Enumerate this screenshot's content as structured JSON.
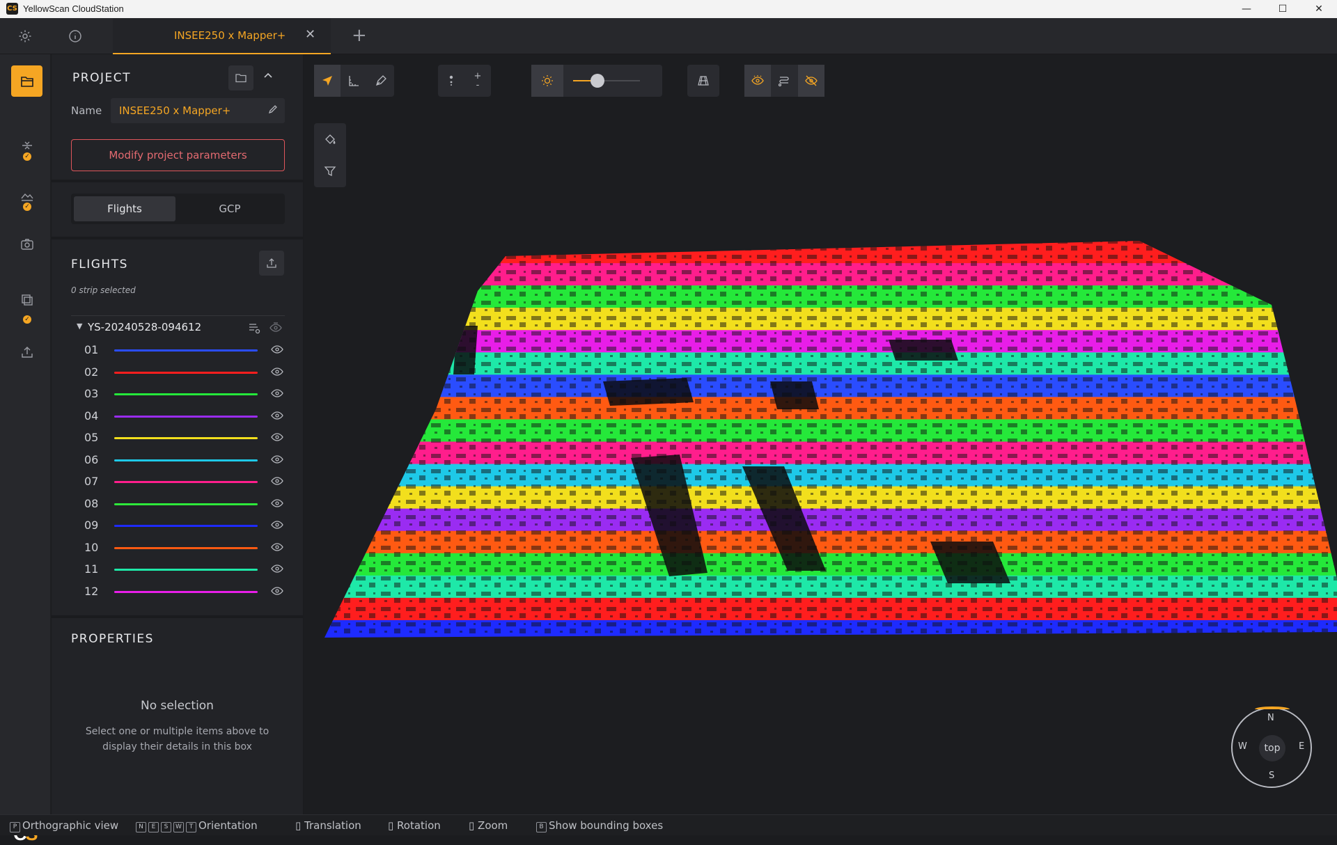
{
  "window": {
    "title": "YellowScan CloudStation",
    "minimize": "—",
    "maximize": "☐",
    "close": "✕",
    "app_badge": "CS"
  },
  "tabs": {
    "active_label": "INSEE250 x Mapper+",
    "close": "✕",
    "add": "+"
  },
  "rail": {
    "logo_c": "C",
    "logo_s": "S"
  },
  "project": {
    "header": "PROJECT",
    "name_label": "Name",
    "name_value": "INSEE250 x Mapper+",
    "modify_button": "Modify project parameters",
    "segment": {
      "flights": "Flights",
      "gcp": "GCP"
    }
  },
  "flights": {
    "header": "FLIGHTS",
    "selection": "0 strip selected",
    "group_name": "YS-20240528-094612",
    "strips": [
      {
        "num": "01",
        "color": "#2a4dff"
      },
      {
        "num": "02",
        "color": "#ff1e1e"
      },
      {
        "num": "03",
        "color": "#25e83a"
      },
      {
        "num": "04",
        "color": "#9a2cf2"
      },
      {
        "num": "05",
        "color": "#f2df1d"
      },
      {
        "num": "06",
        "color": "#1ec9e8"
      },
      {
        "num": "07",
        "color": "#ff1e8c"
      },
      {
        "num": "08",
        "color": "#2ee83a"
      },
      {
        "num": "09",
        "color": "#1e2bff"
      },
      {
        "num": "10",
        "color": "#ff5a12"
      },
      {
        "num": "11",
        "color": "#1ee8a8"
      },
      {
        "num": "12",
        "color": "#e81ee8"
      }
    ]
  },
  "properties": {
    "header": "PROPERTIES",
    "empty_title": "No selection",
    "empty_desc": "Select one or multiple items above to display their details in this box"
  },
  "viewport": {
    "point_size_level": 0.3,
    "compass": {
      "n": "N",
      "e": "E",
      "s": "S",
      "w": "W",
      "center": "top"
    }
  },
  "statusbar": {
    "ortho_key": "P",
    "ortho": "Orthographic view",
    "orient_keys": [
      "N",
      "E",
      "S",
      "W",
      "T"
    ],
    "orient": "Orientation",
    "translation": "Translation",
    "rotation": "Rotation",
    "zoom": "Zoom",
    "bbox_key": "B",
    "bbox": "Show bounding boxes"
  },
  "colors": {
    "accent": "#f5a623",
    "danger": "#e0565b",
    "background": "#1c1d20"
  }
}
